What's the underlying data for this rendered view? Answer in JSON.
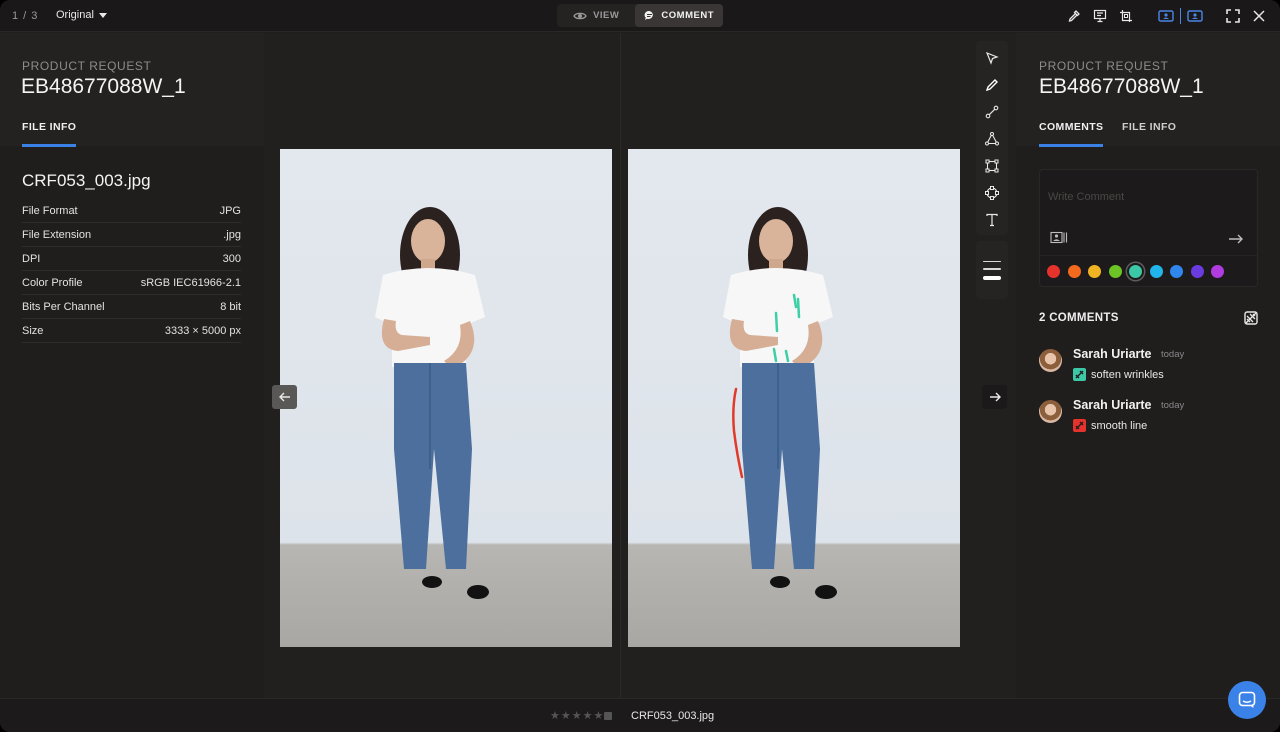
{
  "topbar": {
    "counter": "1 / 3",
    "version_label": "Original",
    "mode_view": "VIEW",
    "mode_comment": "COMMENT",
    "active_mode": "COMMENT",
    "icons": [
      "eyedropper-icon",
      "compare-icon",
      "crop-icon",
      "single-view-icon",
      "split-view-icon",
      "fullscreen-icon",
      "close-icon"
    ]
  },
  "left_panel": {
    "eyebrow": "PRODUCT REQUEST",
    "request_id": "EB48677088W_1",
    "tab": "FILE INFO",
    "file_name": "CRF053_003.jpg",
    "properties": [
      {
        "key": "File Format",
        "value": "JPG"
      },
      {
        "key": "File Extension",
        "value": ".jpg"
      },
      {
        "key": "DPI",
        "value": "300"
      },
      {
        "key": "Color Profile",
        "value": "sRGB IEC61966-2.1"
      },
      {
        "key": "Bits Per Channel",
        "value": "8 bit"
      },
      {
        "key": "Size",
        "value": "3333 × 5000 px"
      }
    ]
  },
  "stage": {
    "tools": [
      "select-arrow-icon",
      "pencil-icon",
      "line-icon",
      "polygon-icon",
      "rectangle-icon",
      "ellipse-icon",
      "text-icon"
    ],
    "active_tool": "pencil-icon",
    "stroke_widths": [
      "thin",
      "medium",
      "thick"
    ],
    "active_stroke": "thick",
    "annotation_colors": {
      "teal": "#3fcfa6",
      "red": "#e03a2a"
    }
  },
  "right_panel": {
    "eyebrow": "PRODUCT REQUEST",
    "request_id": "EB48677088W_1",
    "tabs": [
      "COMMENTS",
      "FILE INFO"
    ],
    "active_tab": "COMMENTS",
    "comment_placeholder": "Write Comment",
    "palette": [
      "#e5322d",
      "#f36a1f",
      "#f0b423",
      "#6cc524",
      "#3cc7a6",
      "#22b5ec",
      "#2f86ec",
      "#6a3ce0",
      "#b03bdf"
    ],
    "selected_color": "#3cc7a6",
    "comments_count_label": "2 COMMENTS",
    "comments": [
      {
        "author": "Sarah Uriarte",
        "time": "today",
        "text": "soften wrinkles",
        "color": "#3cc7a6"
      },
      {
        "author": "Sarah Uriarte",
        "time": "today",
        "text": "smooth line",
        "color": "#e5322d"
      }
    ]
  },
  "bottombar": {
    "rating": 0,
    "max_rating": 5,
    "file_name": "CRF053_003.jpg"
  }
}
